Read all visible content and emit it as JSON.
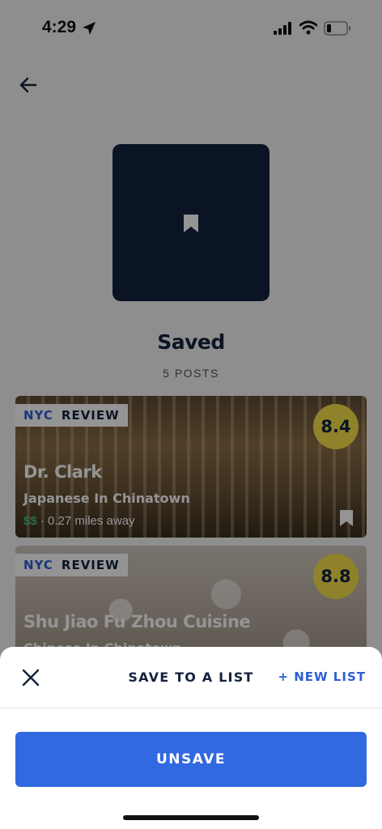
{
  "status_bar": {
    "time": "4:29"
  },
  "collection": {
    "title": "Saved",
    "post_count": "5 POSTS"
  },
  "cards": [
    {
      "city": "NYC",
      "kind": "REVIEW",
      "score": "8.4",
      "name": "Dr. Clark",
      "subtitle": "Japanese In Chinatown",
      "price": "$$",
      "distance": " · 0.27 miles away"
    },
    {
      "city": "NYC",
      "kind": "REVIEW",
      "score": "8.8",
      "name": "Shu Jiao Fu Zhou Cuisine",
      "subtitle": "Chinese In Chinatown"
    }
  ],
  "sheet": {
    "title": "SAVE TO A LIST",
    "new_list": "+ NEW LIST",
    "unsave": "UNSAVE"
  },
  "colors": {
    "navy": "#13233f",
    "accent_blue": "#3169e0",
    "score_yellow": "#f4e14a",
    "price_green": "#3fbf7f"
  },
  "icons": {
    "back": "arrow-left-icon",
    "bookmark": "bookmark-icon",
    "close": "close-icon"
  }
}
